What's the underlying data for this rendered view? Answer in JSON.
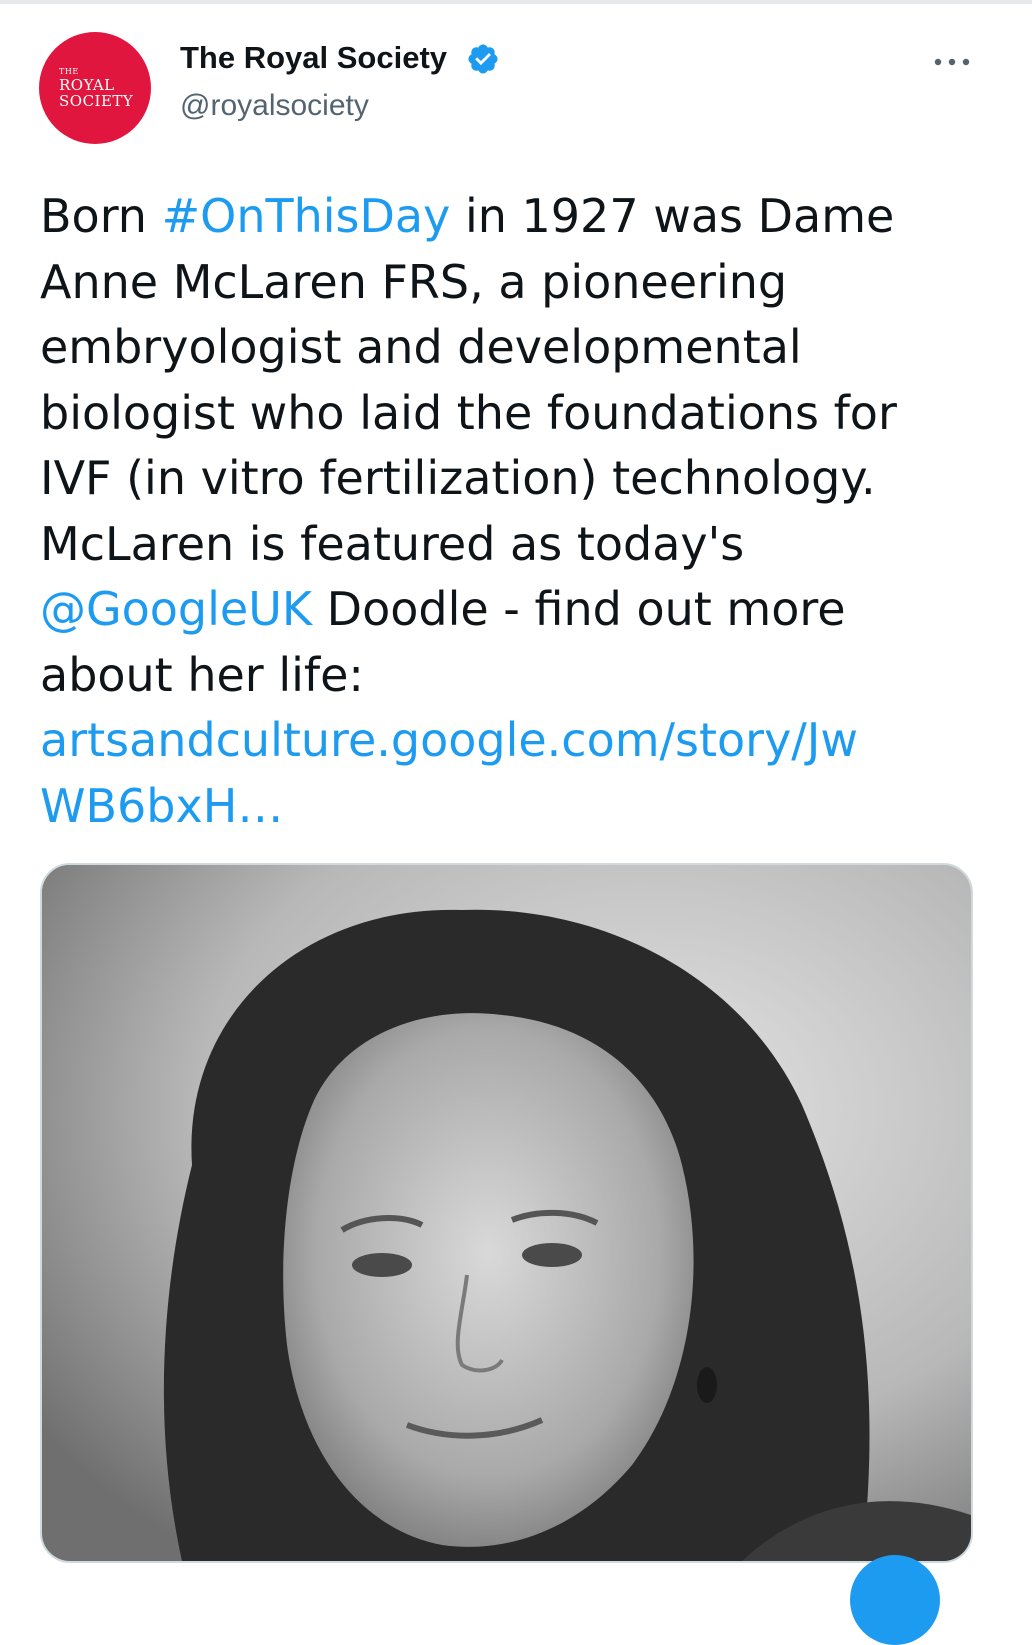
{
  "header": {
    "avatar": {
      "lines": [
        "THE",
        "ROYAL",
        "SOCIETY"
      ],
      "bg_color": "#e0163f"
    },
    "display_name": "The Royal Society",
    "handle": "@royalsociety",
    "verified_icon": "verified-badge-icon",
    "more_icon": "more-options-icon"
  },
  "tweet": {
    "lines": [
      {
        "pre": "Born ",
        "link": "#OnThisDay",
        "post": " in 1927 was Dame"
      },
      {
        "text": "Anne McLaren FRS, a pioneering"
      },
      {
        "text": "embryologist and developmental"
      },
      {
        "text": "biologist who laid the foundations for"
      },
      {
        "text": "IVF (in vitro fertilization) technology."
      },
      {
        "text": "McLaren is featured as today's"
      },
      {
        "link": "@GoogleUK",
        "post": " Doodle - find out more"
      },
      {
        "text": "about her life:"
      },
      {
        "link": "artsandculture.google.com/story/Jw"
      },
      {
        "link": "WB6bxH…"
      }
    ],
    "link_color": "#1d9bf0"
  },
  "colors": {
    "text": "#0f1419",
    "secondary": "#536471",
    "accent": "#1d9bf0"
  }
}
